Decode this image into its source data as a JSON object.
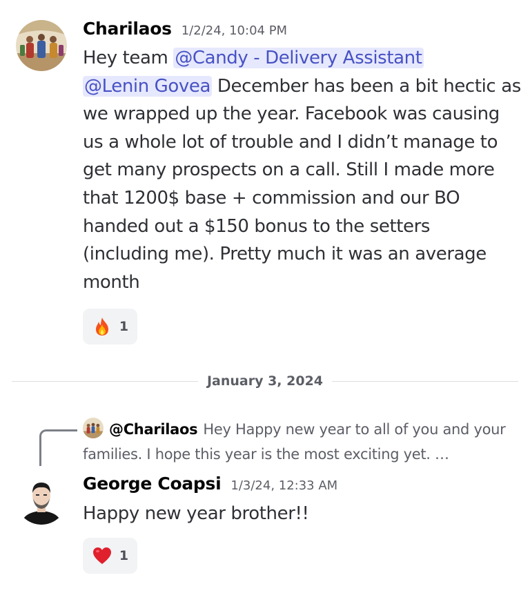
{
  "messages": [
    {
      "author": "Charilaos",
      "timestamp": "1/2/24, 10:04 PM",
      "avatar_icon": "painting-avatar",
      "mentions": [
        "@Candy - Delivery Assistant",
        "@Lenin Govea"
      ],
      "text_line_1": "Hey team ",
      "text_after_mentions": " December has been a bit hectic as we wrapped up the year. Facebook was causing us a whole lot of trouble and I didn’t manage to get many prospects on a call. Still I made more that 1200$ base + commission and our BO handed out a $150 bonus to the setters (including me). Pretty much it was an average month",
      "reaction": {
        "emoji": "fire-emoji",
        "count": "1"
      }
    },
    {
      "author": "George Coapsi",
      "timestamp": "1/3/24, 12:33 AM",
      "avatar_icon": "person-avatar",
      "reply_to": {
        "author": "@Charilaos",
        "preview": "Hey Happy new year to all of you and your families. I hope this year is the most exciting yet. …"
      },
      "text": "Happy new year brother!!",
      "reaction": {
        "emoji": "red-heart-emoji",
        "count": "1"
      }
    }
  ],
  "divider": {
    "label": "January 3, 2024"
  },
  "colors": {
    "mention_bg": "#e6e8fd",
    "mention_text": "#4752c4",
    "reaction_bg": "#f2f3f5"
  }
}
